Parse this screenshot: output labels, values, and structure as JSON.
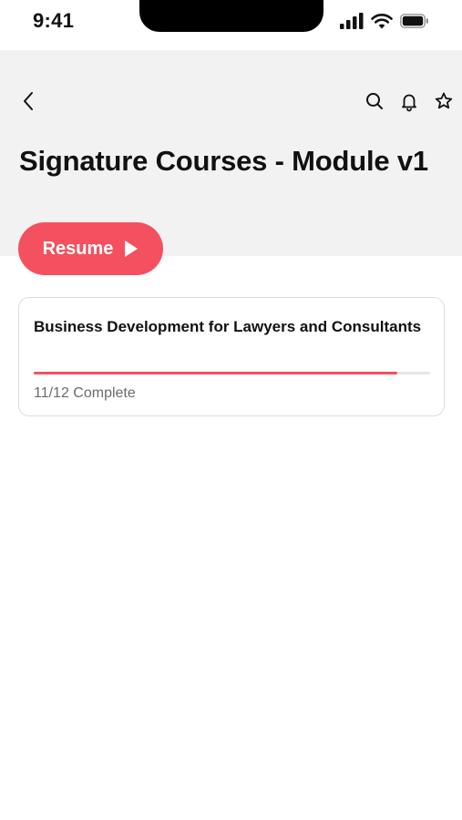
{
  "status_bar": {
    "time": "9:41",
    "icons": [
      "signal-icon",
      "wifi-icon",
      "battery-icon"
    ]
  },
  "header": {
    "title": "Signature Courses - Module v1",
    "back_icon": "chevron-left-icon",
    "actions": [
      "search-icon",
      "bell-icon",
      "star-icon"
    ]
  },
  "resume_button": {
    "label": "Resume",
    "icon": "play-icon"
  },
  "course": {
    "title": "Business Development for Lawyers and Consultants",
    "status": "11/12 Complete",
    "progress": 0.9167
  },
  "colors": {
    "accent": "#f4505f",
    "header_bg": "#f2f2f2",
    "muted_text": "#6b6b6b"
  }
}
